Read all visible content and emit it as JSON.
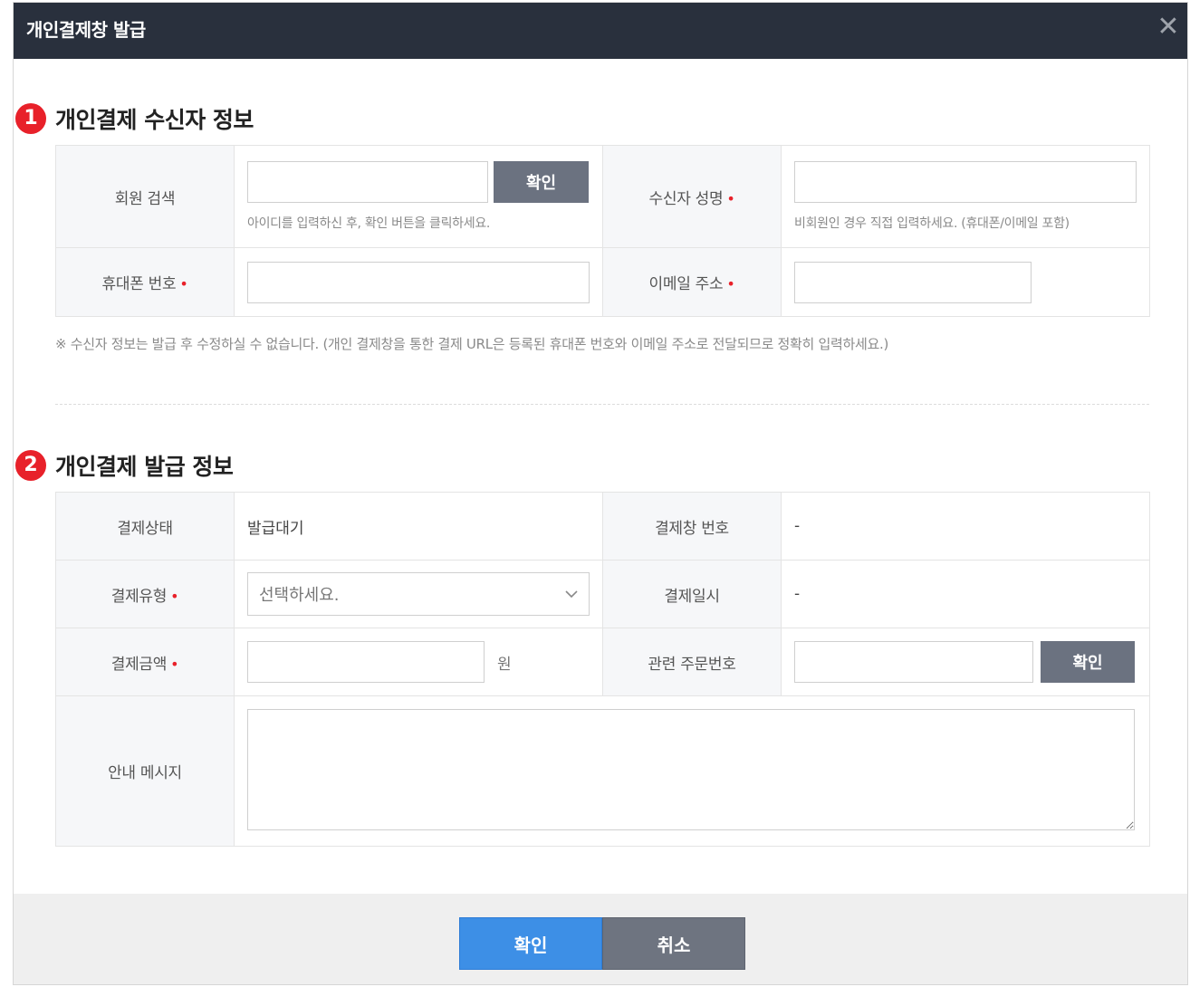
{
  "modal": {
    "title": "개인결제창 발급",
    "close_glyph": "✕"
  },
  "section1": {
    "number": "1",
    "title": "개인결제 수신자 정보",
    "member_search_label": "회원 검색",
    "member_search_value": "",
    "member_confirm_label": "확인",
    "member_search_help": "아이디를 입력하신 후, 확인 버튼을 클릭하세요.",
    "recipient_name_label": "수신자 성명",
    "recipient_name_value": "",
    "recipient_name_help": "비회원인 경우 직접 입력하세요. (휴대폰/이메일 포함)",
    "phone_label": "휴대폰 번호",
    "phone_value": "",
    "email_label": "이메일 주소",
    "email_value": "",
    "required_mark": "•",
    "note": "※ 수신자 정보는 발급 후 수정하실 수 없습니다. (개인 결제창을 통한 결제 URL은 등록된 휴대폰 번호와 이메일 주소로 전달되므로 정확히 입력하세요.)"
  },
  "section2": {
    "number": "2",
    "title": "개인결제 발급 정보",
    "status_label": "결제상태",
    "status_value": "발급대기",
    "window_no_label": "결제창 번호",
    "window_no_value": "-",
    "type_label": "결제유형",
    "type_selected": "선택하세요.",
    "date_label": "결제일시",
    "date_value": "-",
    "amount_label": "결제금액",
    "amount_value": "",
    "amount_unit": "원",
    "order_no_label": "관련 주문번호",
    "order_no_value": "",
    "order_confirm_label": "확인",
    "message_label": "안내 메시지",
    "message_value": ""
  },
  "footer": {
    "confirm_label": "확인",
    "cancel_label": "취소"
  },
  "colors": {
    "header_bg": "#29303d",
    "accent_red": "#e8212a",
    "primary_blue": "#3d8fe6",
    "button_gray": "#6b7280"
  },
  "icons": {
    "close": "close-icon",
    "dropdown": "chevron-down-icon",
    "section_marker": "numbered-circle-icon"
  }
}
